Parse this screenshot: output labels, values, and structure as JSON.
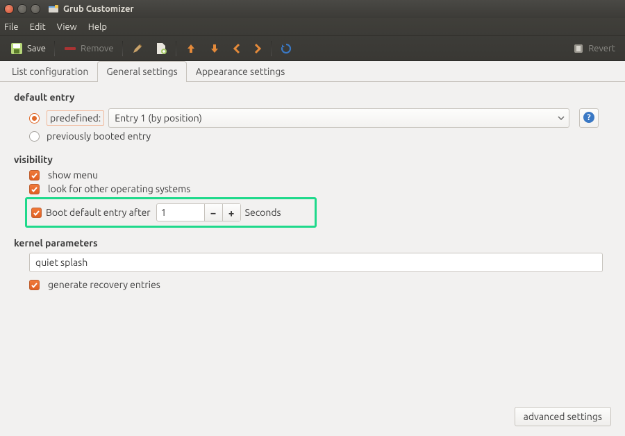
{
  "window": {
    "title": "Grub Customizer"
  },
  "menubar": {
    "file": "File",
    "edit": "Edit",
    "view": "View",
    "help": "Help"
  },
  "toolbar": {
    "save": "Save",
    "remove": "Remove",
    "revert": "Revert"
  },
  "tabs": {
    "list": "List configuration",
    "general": "General settings",
    "appearance": "Appearance settings",
    "active": "general"
  },
  "defaultEntry": {
    "header": "default entry",
    "predefined_label": "predefined:",
    "predefined_value": "Entry 1 (by position)",
    "previously_label": "previously booted entry",
    "mode": "predefined"
  },
  "visibility": {
    "header": "visibility",
    "show_menu": {
      "label": "show menu",
      "checked": true
    },
    "look_other": {
      "label": "look for other operating systems",
      "checked": true
    },
    "boot_after": {
      "label": "Boot default entry after",
      "checked": true,
      "value": "1",
      "unit": "Seconds"
    }
  },
  "kernel": {
    "header": "kernel parameters",
    "value": "quiet splash",
    "recovery": {
      "label": "generate recovery entries",
      "checked": true
    }
  },
  "footer": {
    "advanced": "advanced settings"
  }
}
